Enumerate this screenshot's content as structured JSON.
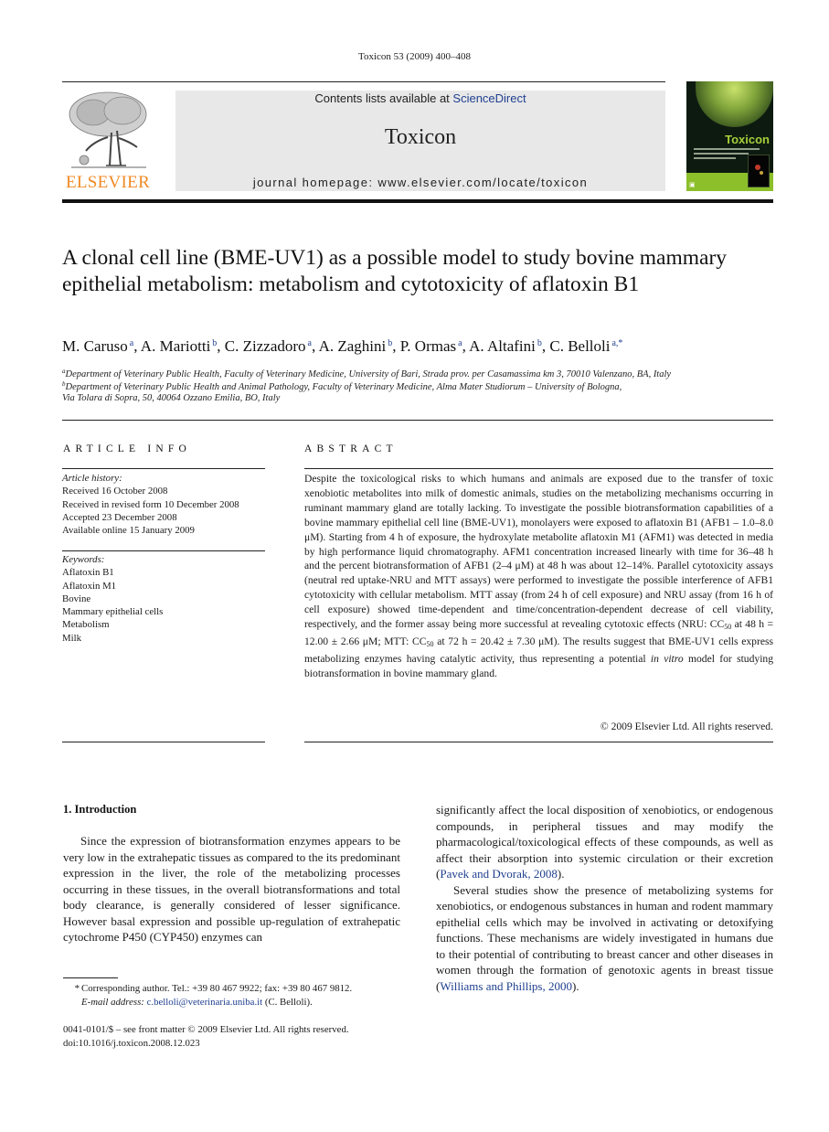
{
  "running_head": "Toxicon 53 (2009) 400–408",
  "masthead": {
    "publisher_logo_text": "ELSEVIER",
    "contents_prefix": "Contents lists available at ",
    "contents_link": "ScienceDirect",
    "journal_name": "Toxicon",
    "homepage": "journal homepage: www.elsevier.com/locate/toxicon",
    "cover_title": "Toxicon",
    "colors": {
      "elsevier_orange": "#f08a24",
      "link_blue": "#1f3f8f",
      "banner_gray": "#e8e8e8"
    }
  },
  "article": {
    "title": "A clonal cell line (BME-UV1) as a possible model to study bovine mammary epithelial metabolism: metabolism and cytotoxicity of aflatoxin B1",
    "authors": [
      {
        "name": "M. Caruso",
        "aff": "a"
      },
      {
        "name": "A. Mariotti",
        "aff": "b"
      },
      {
        "name": "C. Zizzadoro",
        "aff": "a"
      },
      {
        "name": "A. Zaghini",
        "aff": "b"
      },
      {
        "name": "P. Ormas",
        "aff": "a"
      },
      {
        "name": "A. Altafini",
        "aff": "b"
      },
      {
        "name": "C. Belloli",
        "aff": "a,*"
      }
    ],
    "affiliations": [
      {
        "label": "a",
        "text": "Department of Veterinary Public Health, Faculty of Veterinary Medicine, University of Bari, Strada prov. per Casamassima km 3, 70010 Valenzano, BA, Italy"
      },
      {
        "label": "b",
        "text": "Department of Veterinary Public Health and Animal Pathology, Faculty of Veterinary Medicine, Alma Mater Studiorum – University of Bologna,",
        "text2": "Via Tolara di Sopra, 50, 40064 Ozzano Emilia, BO, Italy"
      }
    ]
  },
  "article_info": {
    "heading": "ARTICLE INFO",
    "history_label": "Article history:",
    "history": [
      "Received 16 October 2008",
      "Received in revised form 10 December 2008",
      "Accepted 23 December 2008",
      "Available online 15 January 2009"
    ],
    "keywords_label": "Keywords:",
    "keywords": [
      "Aflatoxin B1",
      "Aflatoxin M1",
      "Bovine",
      "Mammary epithelial cells",
      "Metabolism",
      "Milk"
    ]
  },
  "abstract": {
    "heading": "ABSTRACT",
    "part1": "Despite the toxicological risks to which humans and animals are exposed due to the transfer of toxic xenobiotic metabolites into milk of domestic animals, studies on the metabolizing mechanisms occurring in ruminant mammary gland are totally lacking. To investigate the possible biotransformation capabilities of a bovine mammary epithelial cell line (BME-UV1), monolayers were exposed to aflatoxin B1 (AFB1 – 1.0–8.0 μM). Starting from 4 h of exposure, the hydroxylate metabolite aflatoxin M1 (AFM1) was detected in media by high performance liquid chromatography. AFM1 concentration increased linearly with time for 36–48 h and the percent biotransformation of AFB1 (2–4 μM) at 48 h was about 12–14%. Parallel cytotoxicity assays (neutral red uptake-NRU and MTT assays) were performed to investigate the possible interference of AFB1 cytotoxicity with cellular metabolism. MTT assay (from 24 h of cell exposure) and NRU assay (from 16 h of cell exposure) showed time-dependent and time/concentration-dependent decrease of cell viability, respectively, and the former assay being more successful at revealing cytotoxic effects (NRU: CC",
    "sub1": "50",
    "part2": " at 48 h = 12.00 ± 2.66 μM; MTT: CC",
    "sub2": "50",
    "part3": " at 72 h = 20.42 ± 7.30 μM). The results suggest that BME-UV1 cells express metabolizing enzymes having catalytic activity, thus representing a potential ",
    "italic": "in vitro",
    "part4": " model for studying biotransformation in bovine mammary gland.",
    "copyright": "© 2009 Elsevier Ltd. All rights reserved."
  },
  "body": {
    "section_title": "1.  Introduction",
    "left_paragraph": "Since the expression of biotransformation enzymes appears to be very low in the extrahepatic tissues as compared to the its predominant expression in the liver, the role of the metabolizing processes occurring in these tissues, in the overall biotransformations and total body clearance, is generally considered of lesser significance. However basal expression and possible up-regulation of extrahepatic cytochrome P450 (CYP450) enzymes can",
    "right_p1_text": "significantly affect the local disposition of xenobiotics, or endogenous compounds, in peripheral tissues and may modify the pharmacological/toxicological effects of these compounds, as well as affect their absorption into systemic circulation or their excretion (",
    "right_p1_cite": "Pavek and Dvorak, 2008",
    "right_p1_end": ").",
    "right_p2_text": "Several studies show the presence of metabolizing systems for xenobiotics, or endogenous substances in human and rodent mammary epithelial cells which may be involved in activating or detoxifying functions. These mechanisms are widely investigated in humans due to their potential of contributing to breast cancer and other diseases in women through the formation of genotoxic agents in breast tissue (",
    "right_p2_cite": "Williams and Phillips, 2000",
    "right_p2_end": ")."
  },
  "footnote": {
    "star": "*",
    "corresponding": "Corresponding author. Tel.: +39 80 467 9922; fax: +39 80 467 9812.",
    "email_label": "E-mail address:",
    "email": "c.belloli@veterinaria.uniba.it",
    "email_suffix": " (C. Belloli).",
    "front_matter": "0041-0101/$ – see front matter © 2009 Elsevier Ltd. All rights reserved.",
    "doi": "doi:10.1016/j.toxicon.2008.12.023"
  }
}
